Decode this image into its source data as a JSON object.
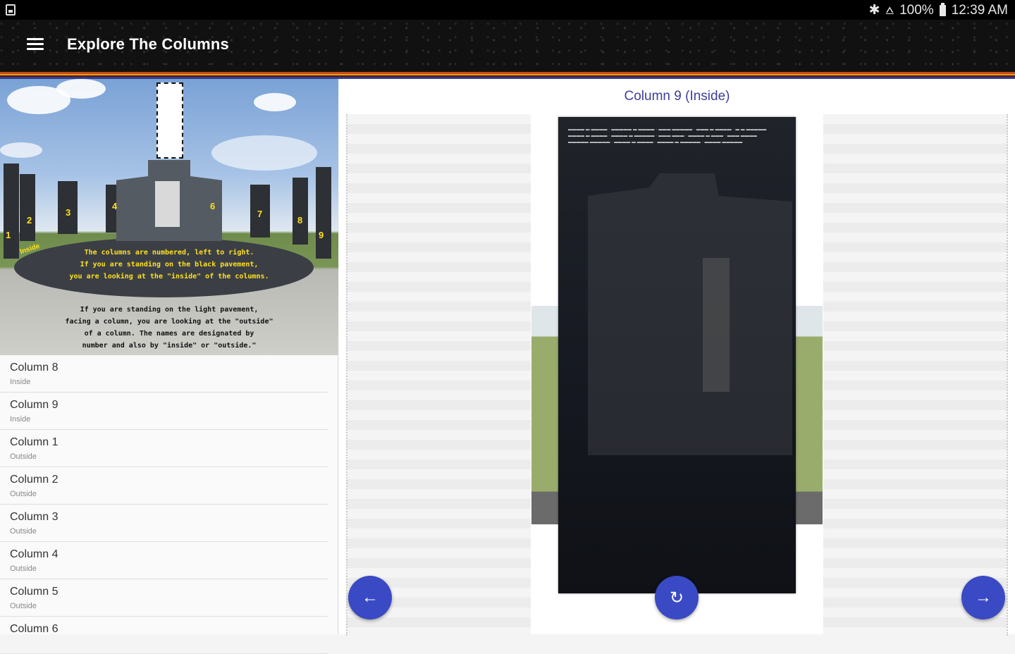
{
  "status_bar": {
    "battery": "100%",
    "time": "12:39 AM",
    "icons": [
      "bluetooth-icon",
      "wifi-icon",
      "battery-icon"
    ]
  },
  "app_bar": {
    "title": "Explore The Columns",
    "menu_icon": "hamburger-menu-icon"
  },
  "hero": {
    "pillar_numbers": [
      "1",
      "2",
      "3",
      "4",
      "6",
      "7",
      "8",
      "9"
    ],
    "inside_label": "Inside",
    "inner_text": [
      "The columns are numbered, left to right.",
      "If you are standing on the black pavement,",
      "you are looking at the \"inside\" of the columns."
    ],
    "outer_text": [
      "If you are standing on the light pavement,",
      "facing a column, you are looking at the \"outside\"",
      "of a column. The names are designated by",
      "number and also by \"inside\" or \"outside.\""
    ]
  },
  "column_list": [
    {
      "title": "Column 8",
      "side": "Inside"
    },
    {
      "title": "Column 9",
      "side": "Inside"
    },
    {
      "title": "Column 1",
      "side": "Outside"
    },
    {
      "title": "Column 2",
      "side": "Outside"
    },
    {
      "title": "Column 3",
      "side": "Outside"
    },
    {
      "title": "Column 4",
      "side": "Outside"
    },
    {
      "title": "Column 5",
      "side": "Outside"
    },
    {
      "title": "Column 6",
      "side": ""
    }
  ],
  "detail": {
    "title": "Column 9 (Inside)",
    "prev_icon": "arrow-left-icon",
    "refresh_icon": "rotate-icon",
    "next_icon": "arrow-right-icon"
  },
  "colors": {
    "accent": "#3a49c4",
    "title_text": "#3d3f9c",
    "app_bar": "#111111"
  }
}
